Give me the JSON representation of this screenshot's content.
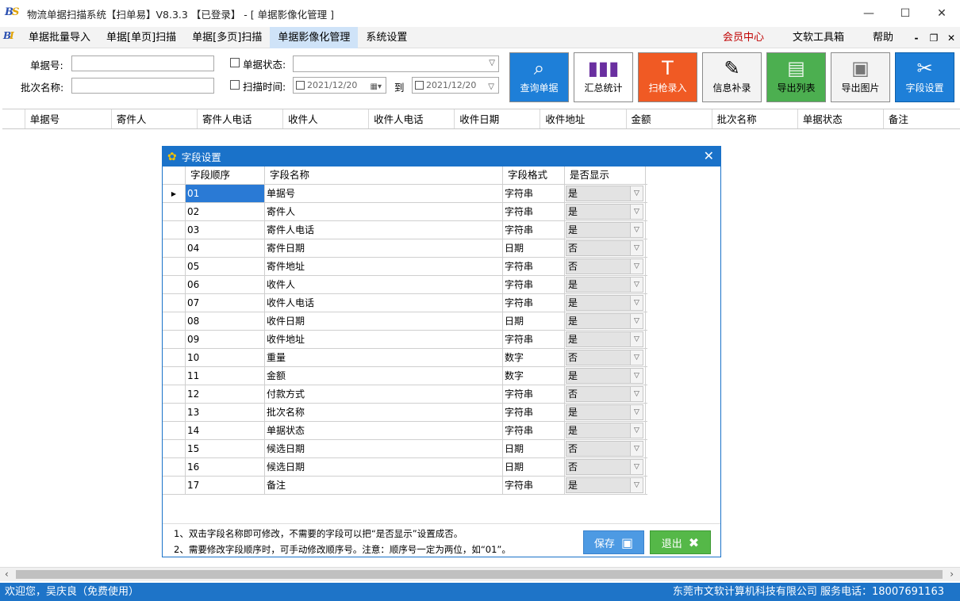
{
  "window": {
    "title": "物流单据扫描系统【扫单易】V8.3.3 【已登录】 - [ 单据影像化管理 ]",
    "logo": "BS",
    "minimize": "—",
    "maximize": "☐",
    "close": "✕"
  },
  "menu": {
    "logo": "BI",
    "items": [
      "单据批量导入",
      "单据[单页]扫描",
      "单据[多页]扫描",
      "单据影像化管理",
      "系统设置"
    ],
    "right_items": [
      "会员中心",
      "文软工具箱",
      "帮助"
    ],
    "mdi": [
      "-",
      "❐",
      "✕"
    ]
  },
  "query": {
    "doc_no_label": "单据号:",
    "batch_label": "批次名称:",
    "status_label": "单据状态:",
    "scan_time_label": "扫描时间:",
    "date_from": "2021/12/20",
    "date_to": "2021/12/20",
    "to_label": "到"
  },
  "toolbar": [
    {
      "label": "查询单据",
      "bg": "#1e7fd8",
      "fg": "#ffffff"
    },
    {
      "label": "汇总统计",
      "bg": "#ffffff",
      "fg": "#000000"
    },
    {
      "label": "扫枪录入",
      "bg": "#f05a24",
      "fg": "#ffffff"
    },
    {
      "label": "信息补录",
      "bg": "#f3f3f3",
      "fg": "#000000"
    },
    {
      "label": "导出列表",
      "bg": "#4caf50",
      "fg": "#000000"
    },
    {
      "label": "导出图片",
      "bg": "#f3f3f3",
      "fg": "#000000"
    },
    {
      "label": "字段设置",
      "bg": "#1e7fd8",
      "fg": "#ffffff"
    }
  ],
  "main_columns": [
    "单据号",
    "寄件人",
    "寄件人电话",
    "收件人",
    "收件人电话",
    "收件日期",
    "收件地址",
    "金额",
    "批次名称",
    "单据状态",
    "备注"
  ],
  "dialog": {
    "title": "字段设置",
    "columns": [
      "字段顺序",
      "字段名称",
      "字段格式",
      "是否显示"
    ],
    "rows": [
      {
        "ord": "01",
        "name": "单据号",
        "fmt": "字符串",
        "show": "是"
      },
      {
        "ord": "02",
        "name": "寄件人",
        "fmt": "字符串",
        "show": "是"
      },
      {
        "ord": "03",
        "name": "寄件人电话",
        "fmt": "字符串",
        "show": "是"
      },
      {
        "ord": "04",
        "name": "寄件日期",
        "fmt": "日期",
        "show": "否"
      },
      {
        "ord": "05",
        "name": "寄件地址",
        "fmt": "字符串",
        "show": "否"
      },
      {
        "ord": "06",
        "name": "收件人",
        "fmt": "字符串",
        "show": "是"
      },
      {
        "ord": "07",
        "name": "收件人电话",
        "fmt": "字符串",
        "show": "是"
      },
      {
        "ord": "08",
        "name": "收件日期",
        "fmt": "日期",
        "show": "是"
      },
      {
        "ord": "09",
        "name": "收件地址",
        "fmt": "字符串",
        "show": "是"
      },
      {
        "ord": "10",
        "name": "重量",
        "fmt": "数字",
        "show": "否"
      },
      {
        "ord": "11",
        "name": "金额",
        "fmt": "数字",
        "show": "是"
      },
      {
        "ord": "12",
        "name": "付款方式",
        "fmt": "字符串",
        "show": "否"
      },
      {
        "ord": "13",
        "name": "批次名称",
        "fmt": "字符串",
        "show": "是"
      },
      {
        "ord": "14",
        "name": "单据状态",
        "fmt": "字符串",
        "show": "是"
      },
      {
        "ord": "15",
        "name": "候选日期",
        "fmt": "日期",
        "show": "否"
      },
      {
        "ord": "16",
        "name": "候选日期",
        "fmt": "日期",
        "show": "否"
      },
      {
        "ord": "17",
        "name": "备注",
        "fmt": "字符串",
        "show": "是"
      }
    ],
    "note1": "1、双击字段名称即可修改，不需要的字段可以把“是否显示”设置成否。",
    "note2": "2、需要修改字段顺序时，可手动修改顺序号。注意：顺序号一定为两位，如“01”。",
    "save_label": "保存",
    "exit_label": "退出"
  },
  "status": {
    "left": "欢迎您，吴庆良（免费使用）",
    "right": "东莞市文软计算机科技有限公司 服务电话：18007691163"
  }
}
